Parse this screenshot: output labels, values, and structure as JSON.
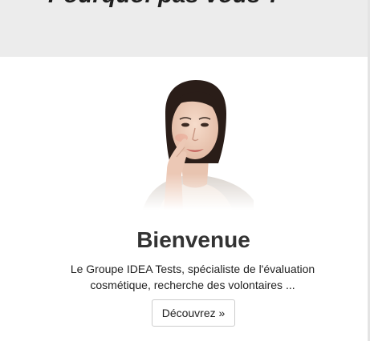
{
  "header": {
    "heading": "Pourquoi pas vous ?"
  },
  "welcome_card": {
    "image": "woman-portrait",
    "title": "Bienvenue",
    "text_line1": "Le Groupe IDEA Tests, spécialiste de l'évaluation",
    "text_line2": "cosmétique, recherche des volontaires ...",
    "button_label": "Découvrez »"
  },
  "colors": {
    "top_band": "#ececec",
    "title": "#333333",
    "button_border": "#cccccc"
  }
}
